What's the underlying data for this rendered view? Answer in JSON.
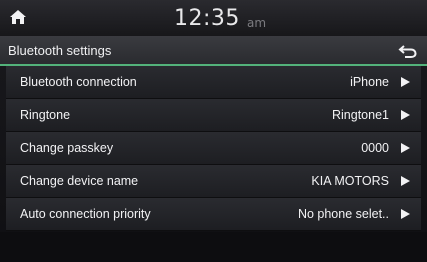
{
  "status": {
    "time": "12:35",
    "ampm": "am"
  },
  "header": {
    "title": "Bluetooth settings"
  },
  "settings": [
    {
      "label": "Bluetooth connection",
      "value": "iPhone"
    },
    {
      "label": "Ringtone",
      "value": "Ringtone1"
    },
    {
      "label": "Change passkey",
      "value": "0000"
    },
    {
      "label": "Change device name",
      "value": "KIA MOTORS"
    },
    {
      "label": "Auto connection priority",
      "value": "No phone selet.."
    }
  ],
  "colors": {
    "accent": "#53b27a"
  },
  "icons": {
    "home": "home-icon",
    "back": "back-arrow-icon",
    "row_arrow": "play-arrow-icon"
  }
}
